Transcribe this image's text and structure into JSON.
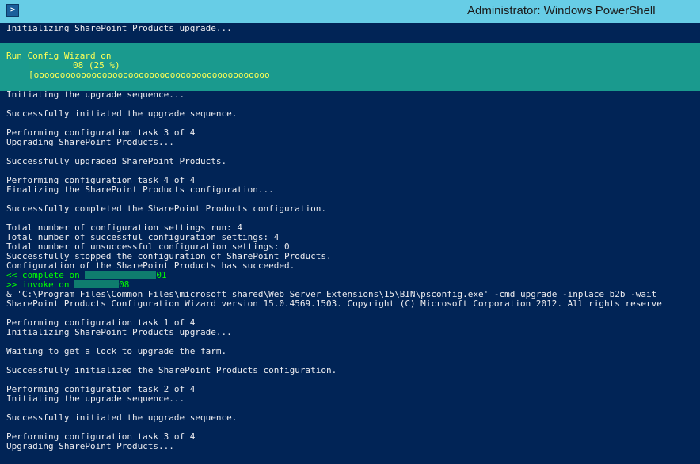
{
  "window": {
    "title": "Administrator: Windows PowerShell",
    "icon": "powershell-icon"
  },
  "progress": {
    "title": "Run Config Wizard on",
    "status_suffix": "08 (25 %)",
    "bar": "[ooooooooooooooooooooooooooooooooooooooooooooo",
    "percent": 25
  },
  "colors": {
    "console_bg": "#012456",
    "titlebar_bg": "#67cde6",
    "progress_bg": "#1a9a8e",
    "progress_text": "#ffff55",
    "highlight_text": "#00ff00",
    "console_text": "#eeedf0"
  },
  "console": {
    "l0": "Initializing SharePoint Products upgrade...",
    "l1": "Initiating the upgrade sequence...",
    "l2": "Successfully initiated the upgrade sequence.",
    "l3": "Performing configuration task 3 of 4",
    "l4": "Upgrading SharePoint Products...",
    "l5": "Successfully upgraded SharePoint Products.",
    "l6": "Performing configuration task 4 of 4",
    "l7": "Finalizing the SharePoint Products configuration...",
    "l8": "Successfully completed the SharePoint Products configuration.",
    "l9": "Total number of configuration settings run: 4",
    "l10": "Total number of successful configuration settings: 4",
    "l11": "Total number of unsuccessful configuration settings: 0",
    "l12": "Successfully stopped the configuration of SharePoint Products.",
    "l13": "Configuration of the SharePoint Products has succeeded.",
    "l14_prefix": "<< complete on",
    "l14_suffix": "01",
    "l15_prefix": ">> invoke on",
    "l15_suffix": "08",
    "l16": "& 'C:\\Program Files\\Common Files\\microsoft shared\\Web Server Extensions\\15\\BIN\\psconfig.exe' -cmd upgrade -inplace b2b -wait",
    "l17": "SharePoint Products Configuration Wizard version 15.0.4569.1503. Copyright (C) Microsoft Corporation 2012. All rights reserve",
    "l18": "Performing configuration task 1 of 4",
    "l19": "Initializing SharePoint Products upgrade...",
    "l20": "Waiting to get a lock to upgrade the farm.",
    "l21": "Successfully initialized the SharePoint Products configuration.",
    "l22": "Performing configuration task 2 of 4",
    "l23": "Initiating the upgrade sequence...",
    "l24": "Successfully initiated the upgrade sequence.",
    "l25": "Performing configuration task 3 of 4",
    "l26": "Upgrading SharePoint Products..."
  }
}
